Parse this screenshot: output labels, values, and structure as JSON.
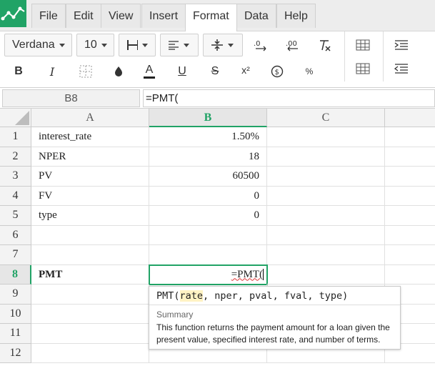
{
  "menu": {
    "items": [
      "File",
      "Edit",
      "View",
      "Insert",
      "Format",
      "Data",
      "Help"
    ],
    "active": "Format"
  },
  "toolbar": {
    "font_family": "Verdana",
    "font_size": "10",
    "icons": {
      "bold": "B",
      "italic": "I",
      "underline": "U",
      "strikethrough": "S",
      "superscript": "x²",
      "percent": "%"
    }
  },
  "formula_bar": {
    "cell_ref": "B8",
    "formula": "=PMT("
  },
  "columns": [
    "A",
    "B",
    "C"
  ],
  "selected_column": "B",
  "rows": [
    {
      "num": "1",
      "a": "interest_rate",
      "b": "1.50%"
    },
    {
      "num": "2",
      "a": "NPER",
      "b": "18"
    },
    {
      "num": "3",
      "a": "PV",
      "b": "60500"
    },
    {
      "num": "4",
      "a": "FV",
      "b": "0"
    },
    {
      "num": "5",
      "a": "type",
      "b": "0"
    },
    {
      "num": "6",
      "a": "",
      "b": ""
    },
    {
      "num": "7",
      "a": "",
      "b": ""
    },
    {
      "num": "8",
      "a": "PMT",
      "b": "=PMT("
    },
    {
      "num": "9",
      "a": "",
      "b": ""
    },
    {
      "num": "10",
      "a": "",
      "b": ""
    },
    {
      "num": "11",
      "a": "",
      "b": ""
    },
    {
      "num": "12",
      "a": "",
      "b": ""
    }
  ],
  "selected_row": "8",
  "tooltip": {
    "fn": "PMT(",
    "arg_current": "rate",
    "args_rest": ", nper, pval, fval, type)",
    "summary_label": "Summary",
    "description": "This function returns the payment amount for a loan given the present value, specified interest rate, and number of terms."
  },
  "colors": {
    "accent": "#21a366"
  }
}
